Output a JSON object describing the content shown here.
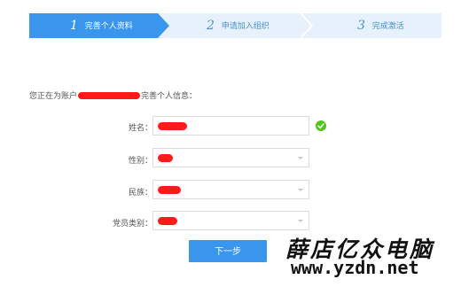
{
  "stepper": {
    "steps": [
      {
        "number": "1",
        "label": "完善个人资料",
        "active": true
      },
      {
        "number": "2",
        "label": "申请加入组织",
        "active": false
      },
      {
        "number": "3",
        "label": "完成激活",
        "active": false
      }
    ],
    "active_color": "#3a96ec",
    "inactive_color": "#e6f1fb"
  },
  "info": {
    "prefix": "您正在为账户",
    "suffix": "完善个人信息："
  },
  "form": {
    "name_label": "姓名：",
    "gender_label": "性别：",
    "ethnicity_label": "民族：",
    "party_label": "党员类别："
  },
  "buttons": {
    "next_label": "下一步"
  },
  "watermark": {
    "title": "薛店亿众电脑",
    "url": "www.yzdn.net"
  },
  "colors": {
    "primary": "#3a96ec",
    "success": "#52c41a",
    "redaction": "#ff1a1a"
  }
}
